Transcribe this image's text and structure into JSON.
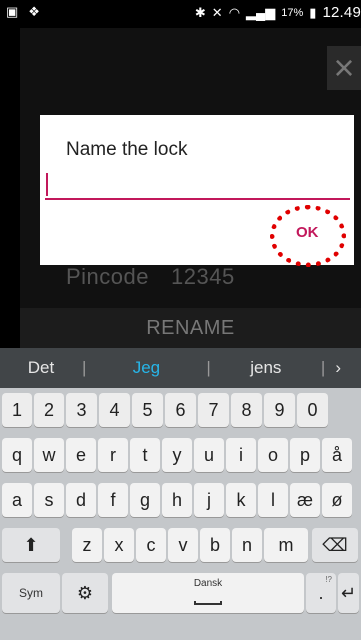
{
  "status_bar": {
    "battery_percent": "17%",
    "time": "12.49"
  },
  "dialog": {
    "title": "Name the lock",
    "input_value": "",
    "ok_label": "OK"
  },
  "background": {
    "pincode_label": "Pincode",
    "pincode_value": "12345",
    "rename_label": "RENAME",
    "close_icon": "close-icon"
  },
  "keyboard": {
    "suggestions": [
      "Det",
      "Jeg",
      "jens"
    ],
    "active_suggestion": "Jeg",
    "number_row": [
      "1",
      "2",
      "3",
      "4",
      "5",
      "6",
      "7",
      "8",
      "9",
      "0"
    ],
    "row1": [
      "q",
      "w",
      "e",
      "r",
      "t",
      "y",
      "u",
      "i",
      "o",
      "p",
      "å"
    ],
    "row2": [
      "a",
      "s",
      "d",
      "f",
      "g",
      "h",
      "j",
      "k",
      "l",
      "æ",
      "ø"
    ],
    "row3": [
      "z",
      "x",
      "c",
      "v",
      "b",
      "n",
      "m"
    ],
    "sym_label": "Sym",
    "space_label": "Dansk",
    "period_label": ".",
    "period_hint": "!?"
  },
  "colors": {
    "accent": "#c2185b",
    "suggestion_active": "#27b5e8",
    "highlight": "#e00000"
  }
}
